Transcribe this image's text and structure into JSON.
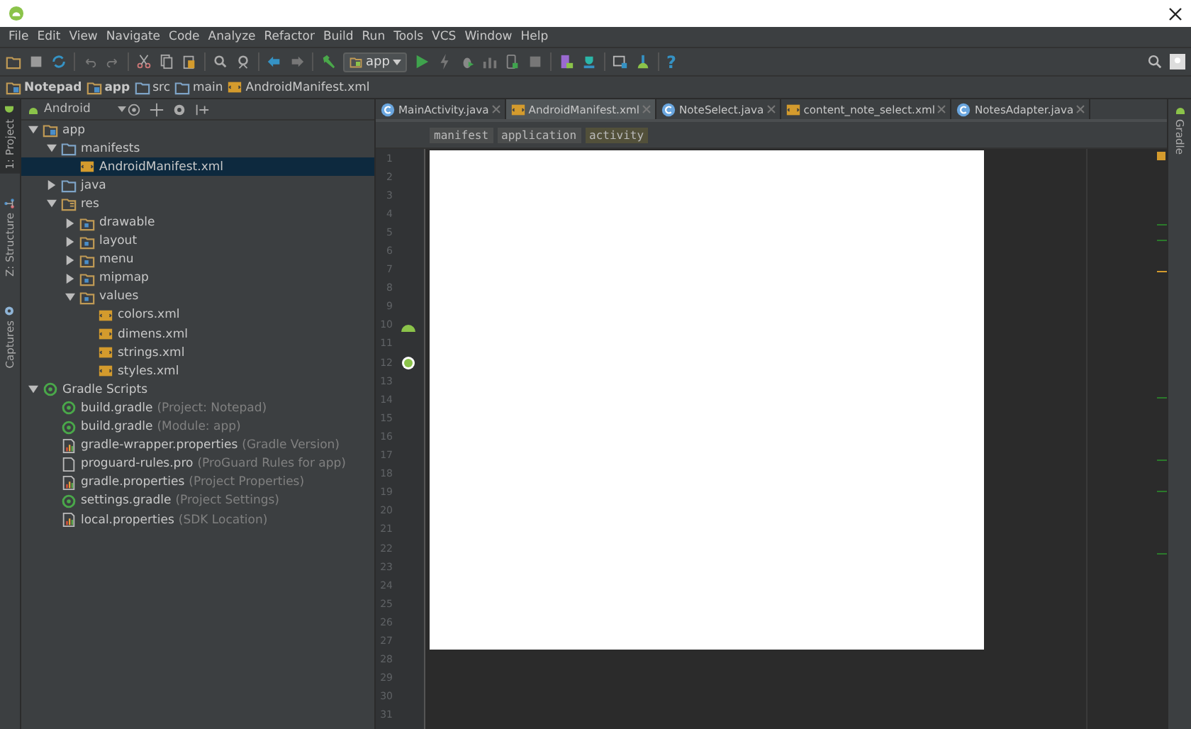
{
  "menu": [
    "File",
    "Edit",
    "View",
    "Navigate",
    "Code",
    "Analyze",
    "Refactor",
    "Build",
    "Run",
    "Tools",
    "VCS",
    "Window",
    "Help"
  ],
  "toolbar": {
    "run_config": "app",
    "help": "?"
  },
  "breadcrumbs": [
    {
      "label": "Notepad",
      "kind": "module",
      "bold": true
    },
    {
      "label": "app",
      "kind": "module",
      "bold": true
    },
    {
      "label": "src",
      "kind": "folder",
      "bold": false
    },
    {
      "label": "main",
      "kind": "folder",
      "bold": false
    },
    {
      "label": "AndroidManifest.xml",
      "kind": "xml",
      "bold": false
    }
  ],
  "left_tool_tabs": [
    {
      "label": "1: Project",
      "kind": "android",
      "selected": true
    },
    {
      "label": "Z: Structure",
      "kind": "structure",
      "selected": false
    },
    {
      "label": "Captures",
      "kind": "camera",
      "selected": false
    }
  ],
  "right_tool_tabs": [
    {
      "label": "Gradle",
      "selected": false
    }
  ],
  "project_panel": {
    "view": "Android",
    "tree": [
      {
        "label": "app",
        "kind": "module",
        "selected": false,
        "expanded": true,
        "children": [
          {
            "label": "manifests",
            "kind": "folder",
            "selected": false,
            "expanded": true,
            "children": [
              {
                "label": "AndroidManifest.xml",
                "kind": "xml",
                "selected": true
              }
            ]
          },
          {
            "label": "java",
            "kind": "folder",
            "selected": false,
            "expanded": false
          },
          {
            "label": "res",
            "kind": "res",
            "selected": false,
            "expanded": true,
            "children": [
              {
                "label": "drawable",
                "kind": "resdir",
                "selected": false,
                "expanded": false
              },
              {
                "label": "layout",
                "kind": "resdir",
                "selected": false,
                "expanded": false
              },
              {
                "label": "menu",
                "kind": "resdir",
                "selected": false,
                "expanded": false
              },
              {
                "label": "mipmap",
                "kind": "resdir",
                "selected": false,
                "expanded": false
              },
              {
                "label": "values",
                "kind": "resdir",
                "selected": false,
                "expanded": true,
                "children": [
                  {
                    "label": "colors.xml",
                    "kind": "xml",
                    "selected": false
                  },
                  {
                    "label": "dimens.xml",
                    "kind": "xml",
                    "selected": false
                  },
                  {
                    "label": "strings.xml",
                    "kind": "xml",
                    "selected": false
                  },
                  {
                    "label": "styles.xml",
                    "kind": "xml",
                    "selected": false
                  }
                ]
              }
            ]
          }
        ]
      },
      {
        "label": "Gradle Scripts",
        "kind": "gradle",
        "selected": false,
        "expanded": true,
        "children": [
          {
            "label": "build.gradle",
            "hint": "(Project: Notepad)",
            "kind": "gradle",
            "selected": false
          },
          {
            "label": "build.gradle",
            "hint": "(Module: app)",
            "kind": "gradle",
            "selected": false
          },
          {
            "label": "gradle-wrapper.properties",
            "hint": "(Gradle Version)",
            "kind": "props",
            "selected": false
          },
          {
            "label": "proguard-rules.pro",
            "hint": "(ProGuard Rules for app)",
            "kind": "file",
            "selected": false
          },
          {
            "label": "gradle.properties",
            "hint": "(Project Properties)",
            "kind": "props",
            "selected": false
          },
          {
            "label": "settings.gradle",
            "hint": "(Project Settings)",
            "kind": "gradle",
            "selected": false
          },
          {
            "label": "local.properties",
            "hint": "(SDK Location)",
            "kind": "props",
            "selected": false
          }
        ]
      }
    ]
  },
  "editor_tabs": [
    {
      "label": "MainActivity.java",
      "kind": "class",
      "selected": false
    },
    {
      "label": "AndroidManifest.xml",
      "kind": "xml",
      "selected": true
    },
    {
      "label": "NoteSelect.java",
      "kind": "class",
      "selected": false
    },
    {
      "label": "content_note_select.xml",
      "kind": "xml",
      "selected": false
    },
    {
      "label": "NotesAdapter.java",
      "kind": "class",
      "selected": false
    }
  ],
  "tag_path": [
    {
      "label": "manifest",
      "selected": false
    },
    {
      "label": "application",
      "selected": false
    },
    {
      "label": "activity",
      "selected": true
    }
  ],
  "line_numbers": [
    "1",
    "2",
    "3",
    "4",
    "5",
    "6",
    "7",
    "8",
    "9",
    "10",
    "11",
    "12",
    "13",
    "14",
    "15",
    "16",
    "17",
    "18",
    "19",
    "20",
    "21",
    "22",
    "23",
    "24",
    "25",
    "26",
    "27",
    "28",
    "29",
    "30",
    "31"
  ]
}
